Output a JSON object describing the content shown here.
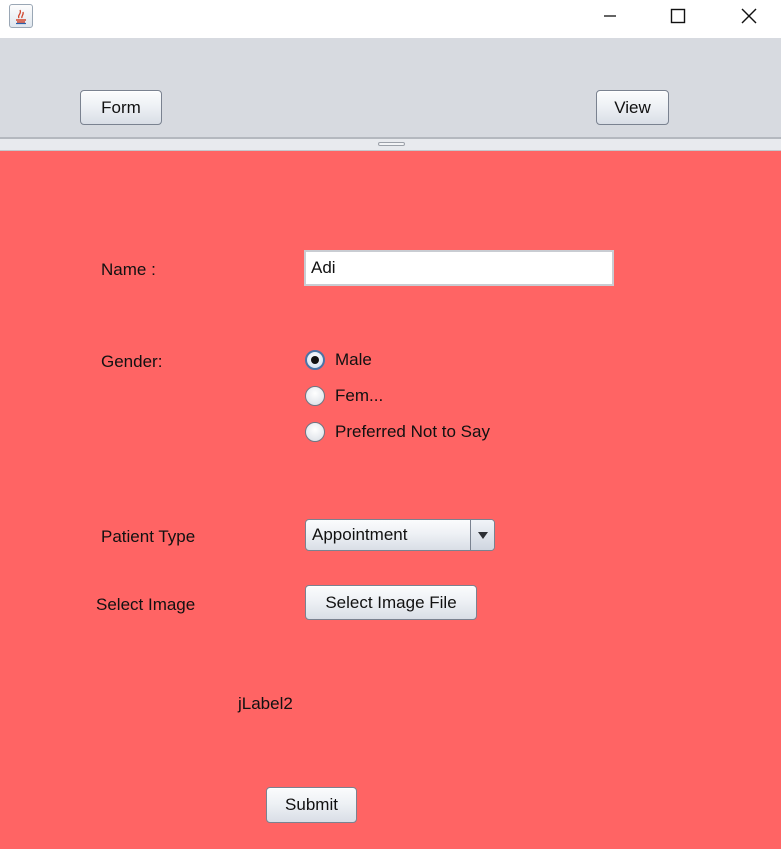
{
  "window": {
    "controls": {
      "minimize": "minimize-icon",
      "maximize": "maximize-icon",
      "close": "close-icon"
    }
  },
  "toolbar": {
    "form_label": "Form",
    "view_label": "View"
  },
  "form": {
    "name_label": "Name :",
    "name_value": "Adi",
    "gender_label": "Gender:",
    "gender_options": [
      {
        "label": "Male",
        "checked": true
      },
      {
        "label": "Fem...",
        "checked": false
      },
      {
        "label": "Preferred Not to Say",
        "checked": false
      }
    ],
    "patient_type_label": "Patient Type",
    "patient_type_value": "Appointment",
    "select_image_label": "Select Image",
    "select_image_button": "Select Image File",
    "image_preview_label": "jLabel2",
    "submit_label": "Submit"
  },
  "colors": {
    "form_background": "#ff6464",
    "toolbar_background": "#d7dae0",
    "radio_checked_border": "#4a74a6"
  }
}
